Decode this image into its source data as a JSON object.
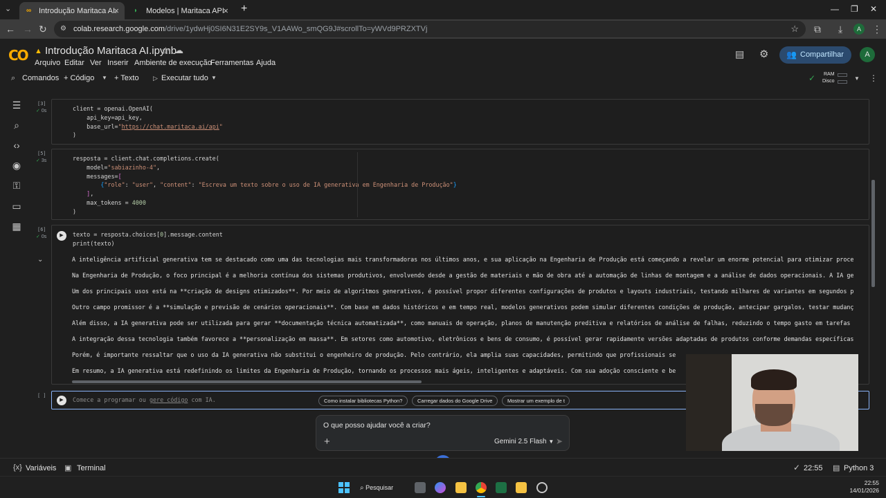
{
  "browser": {
    "tabs": [
      {
        "title": "Introdução Maritaca AI.ipynb - C",
        "active": true
      },
      {
        "title": "Modelos | Maritaca API Docum",
        "active": false
      }
    ],
    "url_host": "colab.research.google.com",
    "url_path": "/drive/1ydwHj0SI6N31E2SY9s_V1AAWo_smQG9J#scrollTo=yWVd9PRZXTVj",
    "profile_letter": "A"
  },
  "colab": {
    "logo_text": "CO",
    "notebook_title": "Introdução Maritaca AI.ipynb",
    "menu": [
      "Arquivo",
      "Editar",
      "Ver",
      "Inserir",
      "Ambiente de execução",
      "Ferramentas",
      "Ajuda"
    ],
    "share_label": "Compartilhar",
    "avatar_letter": "A",
    "toolbar": {
      "commands": "Comandos",
      "code": "+ Código",
      "text": "+ Texto",
      "run_all": "Executar tudo"
    },
    "resources": {
      "ram": "RAM",
      "disk": "Disco"
    }
  },
  "cells": [
    {
      "number": "[3]",
      "time": "0s",
      "lines": [
        "client = openai.OpenAI(",
        "    api_key=api_key,",
        "    base_url=\"https://chat.maritaca.ai/api\"",
        ")"
      ]
    },
    {
      "number": "[5]",
      "time": "3s",
      "lines": [
        "resposta = client.chat.completions.create(",
        "    model=\"sabiazinho-4\",",
        "    messages=[",
        "        {\"role\": \"user\", \"content\": \"Escreva um texto sobre o uso de IA generativa em Engenharia de Produção\"}",
        "    ],",
        "    max_tokens = 4000",
        ")"
      ]
    },
    {
      "number": "[6]",
      "time": "0s",
      "lines": [
        "texto = resposta.choices[0].message.content",
        "print(texto)"
      ]
    }
  ],
  "output_lines": [
    "A inteligência artificial generativa tem se destacado como uma das tecnologias mais transformadoras nos últimos anos, e sua aplicação na Engenharia de Produção está começando a revelar um enorme potencial para otimizar proce",
    "Na Engenharia de Produção, o foco principal é a melhoria contínua dos sistemas produtivos, envolvendo desde a gestão de materiais e mão de obra até a automação de linhas de montagem e a análise de dados operacionais. A IA ge",
    "Um dos principais usos está na **criação de designs otimizados**. Por meio de algoritmos generativos, é possível propor diferentes configurações de produtos e layouts industriais, testando milhares de variantes em segundos p",
    "Outro campo promissor é a **simulação e previsão de cenários operacionais**. Com base em dados históricos e em tempo real, modelos generativos podem simular diferentes condições de produção, antecipar gargalos, testar mudanç",
    "Além disso, a IA generativa pode ser utilizada para gerar **documentação técnica automatizada**, como manuais de operação, planos de manutenção preditiva e relatórios de análise de falhas, reduzindo o tempo gasto em tarefas",
    "A integração dessa tecnologia também favorece a **personalização em massa**. Em setores como automotivo, eletrônicos e bens de consumo, é possível gerar rapidamente versões adaptadas de produtos conforme demandas específicas",
    "Porém, é importante ressaltar que o uso da IA generativa não substitui o engenheiro de produção. Pelo contrário, ela amplia suas capacidades, permitindo que profissionais se",
    "Em resumo, a IA generativa está redefinindo os limites da Engenharia de Produção, tornando os processos mais ágeis, inteligentes e adaptáveis. Com sua adoção consciente e be"
  ],
  "new_cell": {
    "bracket": "[ ]",
    "placeholder_start": "Comece a programar ou ",
    "placeholder_link": "gere código",
    "placeholder_end": " com IA.",
    "chips": [
      "Como instalar bibliotecas Python?",
      "Carregar dados do Google Drive",
      "Mostrar um exemplo de t"
    ]
  },
  "gemini": {
    "prompt": "O que posso ajudar você a criar?",
    "plus": "+",
    "model": "Gemini 2.5 Flash"
  },
  "status": {
    "variables": "Variáveis",
    "terminal": "Terminal",
    "time": "22:55",
    "runtime": "Python 3"
  },
  "taskbar": {
    "search": "Pesquisar",
    "clock_time": "22:55",
    "clock_date": "14/01/2026"
  },
  "colors": {
    "colab_orange": "#f9ab00",
    "share_bg": "#2b4a6e",
    "link_blue": "#8ab4f8",
    "string_color": "#ce9178",
    "number_color": "#b5cea8"
  }
}
